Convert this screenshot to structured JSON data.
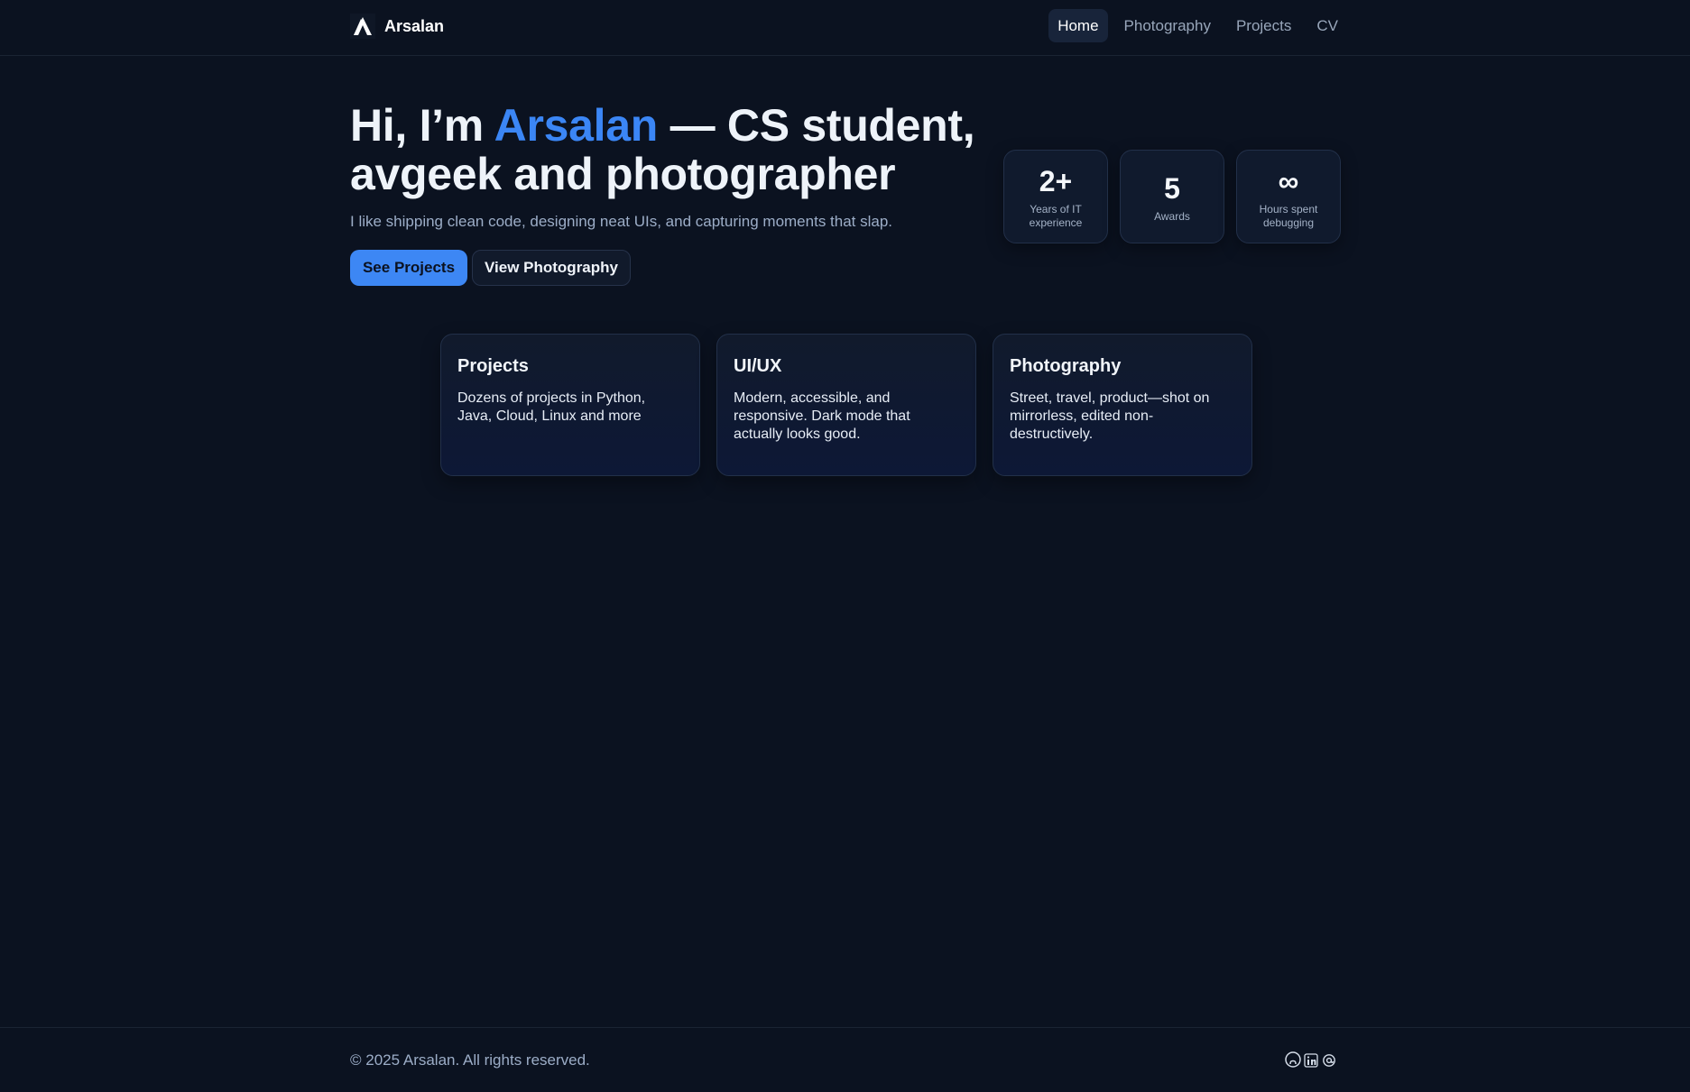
{
  "nav": {
    "brand": "Arsalan",
    "links": [
      {
        "label": "Home",
        "active": true
      },
      {
        "label": "Photography",
        "active": false
      },
      {
        "label": "Projects",
        "active": false
      },
      {
        "label": "CV",
        "active": false
      }
    ]
  },
  "hero": {
    "title_pre": "Hi, I’m ",
    "title_accent": "Arsalan",
    "title_post": " — CS student, avgeek and photographer",
    "subtitle": "I like shipping clean code, designing neat UIs, and capturing moments that slap.",
    "primary_button": "See Projects",
    "secondary_button": "View Photography"
  },
  "stats": [
    {
      "value": "2+",
      "label": "Years of IT experience"
    },
    {
      "value": "5",
      "label": "Awards"
    },
    {
      "value": "∞",
      "label": "Hours spent debugging"
    }
  ],
  "cards": [
    {
      "title": "Projects",
      "text": "Dozens of projects in Python, Java, Cloud, Linux and more"
    },
    {
      "title": "UI/UX",
      "text": "Modern, accessible, and responsive. Dark mode that actually looks good."
    },
    {
      "title": "Photography",
      "text": "Street, travel, product—shot on mirrorless, edited non-destructively."
    }
  ],
  "footer": {
    "copyright": "© 2025 Arsalan. All rights reserved.",
    "icons": [
      "github-icon",
      "linkedin-icon",
      "email-icon"
    ]
  },
  "colors": {
    "background": "#0b1220",
    "accent": "#3b86f5",
    "card": "#101a2d"
  }
}
